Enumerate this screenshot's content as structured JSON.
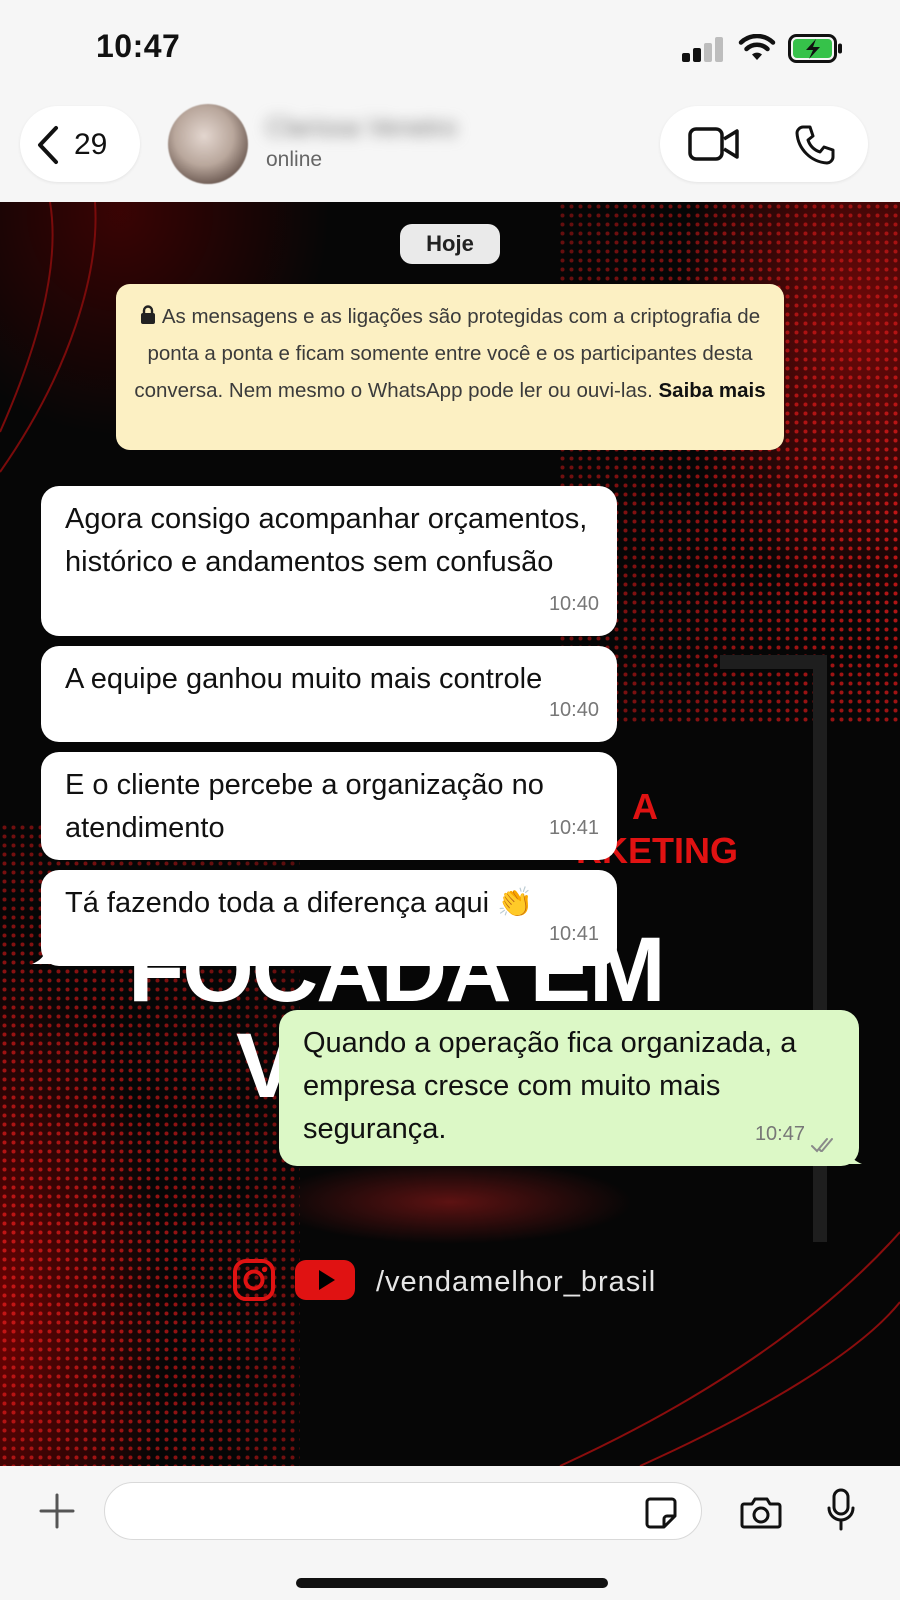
{
  "status_bar": {
    "time": "10:47",
    "icons": [
      "cellular-signal-icon",
      "wifi-icon",
      "battery-charging-icon"
    ]
  },
  "header": {
    "back_count": "29",
    "contact_name": "Clarissa Venetro",
    "contact_status": "online",
    "icons": [
      "chevron-left-icon",
      "video-call-icon",
      "phone-icon"
    ]
  },
  "chat": {
    "date_label": "Hoje",
    "encryption_notice": {
      "text": "As mensagens e as ligações são protegidas com a criptografia de ponta a ponta e ficam somente entre você e os participantes desta conversa. Nem mesmo o WhatsApp pode ler ou ouvi-las.",
      "link": "Saiba mais"
    },
    "messages": [
      {
        "direction": "in",
        "text": "Agora consigo acompanhar orçamentos, histórico e andamentos sem confusão",
        "time": "10:40"
      },
      {
        "direction": "in",
        "text": "A equipe ganhou muito mais controle",
        "time": "10:40"
      },
      {
        "direction": "in",
        "text": "E o cliente percebe a organização no atendimento",
        "time": "10:41"
      },
      {
        "direction": "in",
        "text": "Tá fazendo toda a diferença aqui 👏",
        "time": "10:41"
      },
      {
        "direction": "out",
        "text": "Quando a operação fica organizada, a empresa cresce com muito mais segurança.",
        "time": "10:47",
        "status": "read"
      }
    ]
  },
  "background": {
    "big_text_1": "FOCADA EM",
    "big_text_2": "V",
    "red_text_1": "A",
    "red_text_2": "RKETING",
    "handle": "/vendamelhor_brasil",
    "icons": [
      "instagram-icon",
      "youtube-icon"
    ],
    "accent_color": "#e01212"
  },
  "composer": {
    "placeholder": "",
    "icons": [
      "plus-icon",
      "sticker-icon",
      "camera-icon",
      "microphone-icon"
    ]
  },
  "colors": {
    "incoming_bubble": "#ffffff",
    "outgoing_bubble": "#dcf8c6",
    "notice_background": "#fcf0c3"
  }
}
